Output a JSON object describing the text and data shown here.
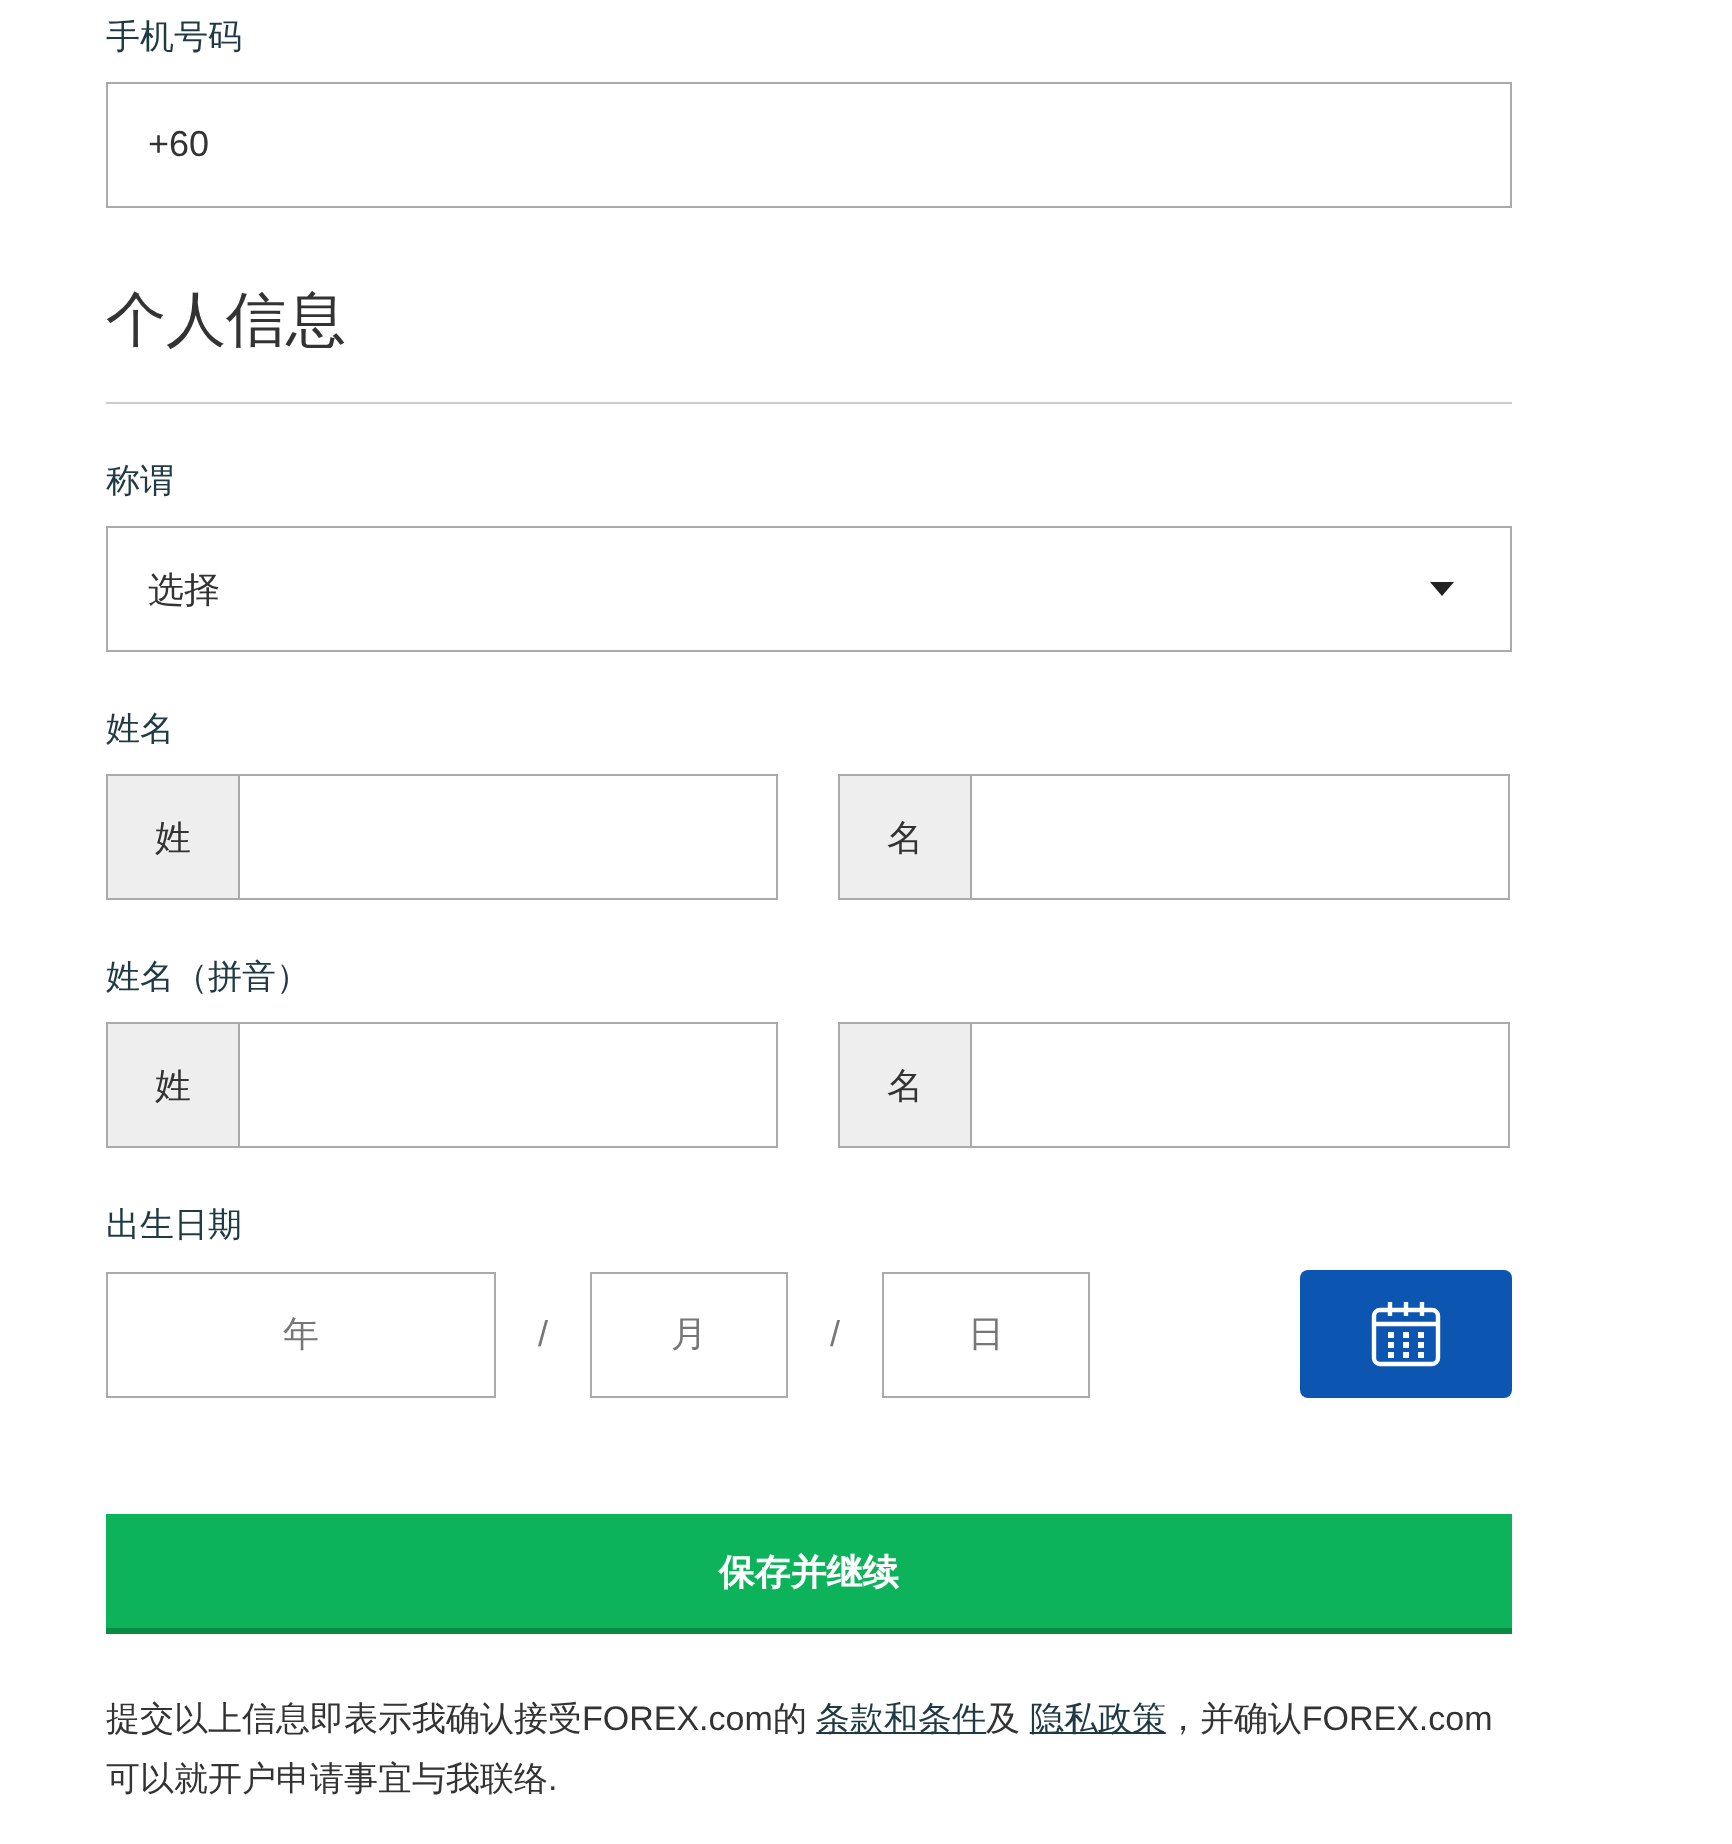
{
  "phone": {
    "label": "手机号码",
    "value": "+60"
  },
  "section_title": "个人信息",
  "salutation": {
    "label": "称谓",
    "value": "选择"
  },
  "name_groups": [
    {
      "label": "姓名",
      "fields": [
        {
          "addon": "姓"
        },
        {
          "addon": "名"
        }
      ]
    },
    {
      "label": "姓名（拼音）",
      "fields": [
        {
          "addon": "姓"
        },
        {
          "addon": "名"
        }
      ]
    }
  ],
  "birth_date": {
    "label": "出生日期",
    "parts": [
      {
        "kind": "field",
        "placeholder": "年"
      },
      {
        "kind": "separator",
        "text": "/"
      },
      {
        "kind": "field",
        "placeholder": "月"
      },
      {
        "kind": "separator",
        "text": "/"
      },
      {
        "kind": "field",
        "placeholder": "日"
      }
    ]
  },
  "submit_button": "保存并继续",
  "consent": [
    {
      "kind": "text",
      "text": "提交以上信息即表示我确认接受FOREX.com的 "
    },
    {
      "kind": "link",
      "text": "条款和条件"
    },
    {
      "kind": "text",
      "text": "及 "
    },
    {
      "kind": "link",
      "text": "隐私政策"
    },
    {
      "kind": "text",
      "text": "，并确认FOREX.com可以就开户申请事宜与我联络."
    }
  ]
}
